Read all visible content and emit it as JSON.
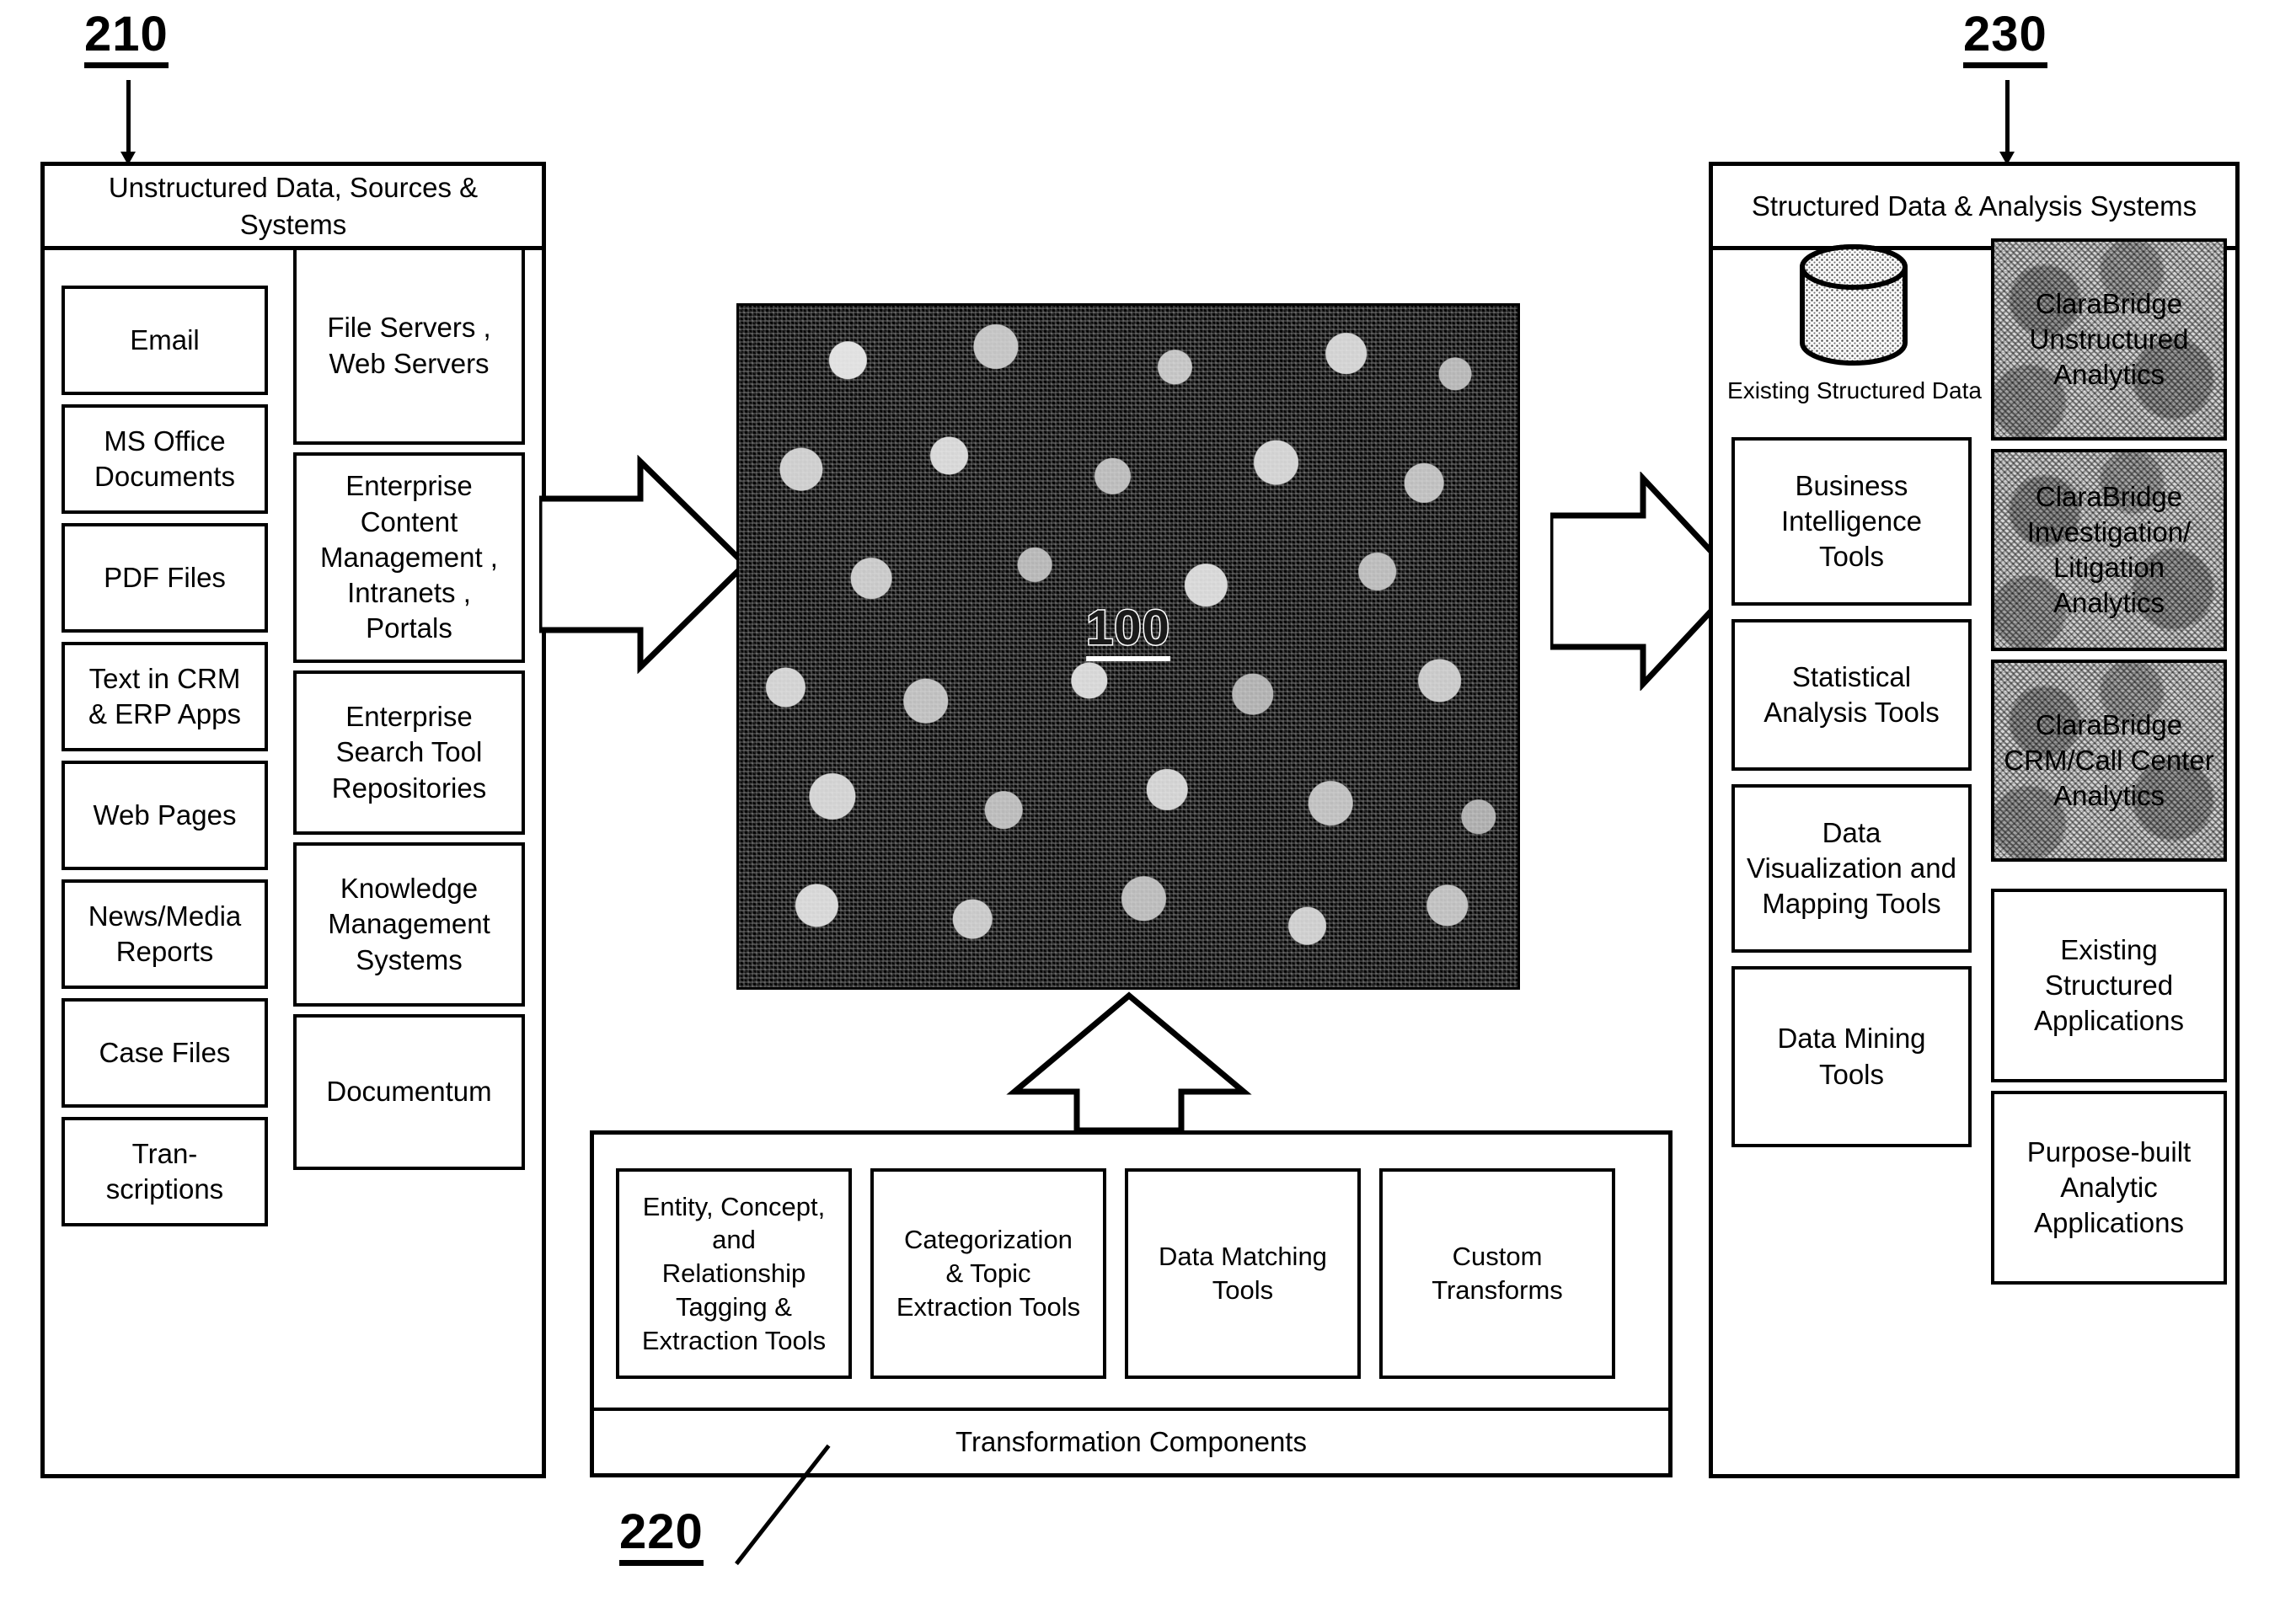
{
  "figure": {
    "ref_left": "210",
    "ref_right": "230",
    "ref_bottom": "220",
    "ref_center": "100"
  },
  "left_panel": {
    "title": "Unstructured Data,\nSources & Systems",
    "column_a": [
      "Email",
      "MS Office\nDocuments",
      "PDF Files",
      "Text in CRM\n& ERP Apps",
      "Web Pages",
      "News/Media\nReports",
      "Case Files",
      "Tran-\nscriptions"
    ],
    "column_b": [
      "File Servers ,\nWeb Servers",
      "Enterprise\nContent\nManagement ,\nIntranets ,\nPortals",
      "Enterprise\nSearch Tool\nRepositories",
      "Knowledge\nManagement\nSystems",
      "Documentum"
    ]
  },
  "center": {
    "label": "100"
  },
  "bottom_panel": {
    "footer_label": "Transformation Components",
    "components": [
      "Entity, Concept,\nand\nRelationship\nTagging  &\nExtraction Tools",
      "Categorization\n& Topic\nExtraction Tools",
      "Data Matching\nTools",
      "Custom\nTransforms"
    ]
  },
  "right_panel": {
    "title": "Structured Data & Analysis Systems",
    "database_icon_label": "Existing Structured Data",
    "column_a": [
      "Business\nIntelligence\nTools",
      "Statistical\nAnalysis Tools",
      "Data\nVisualization and\nMapping Tools",
      "Data Mining\nTools"
    ],
    "column_b": [
      "ClaraBridge\nUnstructured\nAnalytics",
      "ClaraBridge\nInvestigation/\nLitigation\nAnalytics",
      "ClaraBridge\nCRM/Call Center\nAnalytics",
      "Existing\nStructured\nApplications",
      "Purpose-built\nAnalytic\nApplications"
    ],
    "column_b_shaded": [
      true,
      true,
      true,
      false,
      false
    ]
  },
  "colors": {
    "line": "#000000",
    "background": "#ffffff",
    "shade": "#d6d6d6"
  }
}
